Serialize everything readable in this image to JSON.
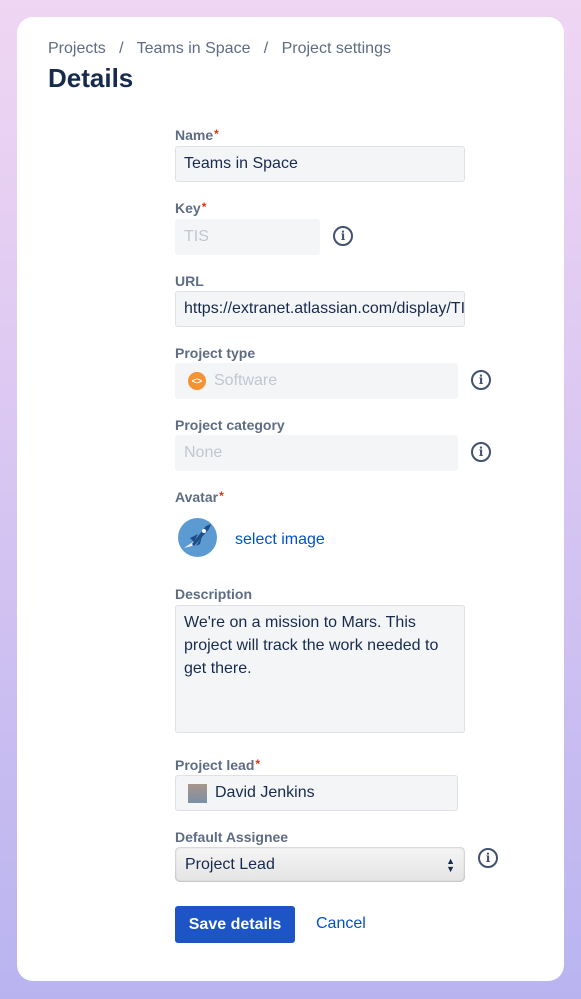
{
  "breadcrumbs": [
    "Projects",
    "Teams in Space",
    "Project settings"
  ],
  "page_title": "Details",
  "fields": {
    "name": {
      "label": "Name",
      "value": "Teams in Space",
      "required": true
    },
    "key": {
      "label": "Key",
      "value": "TIS",
      "required": true
    },
    "url": {
      "label": "URL",
      "value": "https://extranet.atlassian.com/display/TIS"
    },
    "project_type": {
      "label": "Project type",
      "value": "Software",
      "icon": "code-icon",
      "icon_color": "#f79232"
    },
    "project_category": {
      "label": "Project category",
      "placeholder": "None"
    },
    "avatar": {
      "label": "Avatar",
      "link": "select image",
      "required": true
    },
    "description": {
      "label": "Description",
      "value": "We're on a mission to Mars. This project will track the work needed to get there."
    },
    "project_lead": {
      "label": "Project lead",
      "value": "David Jenkins",
      "required": true
    },
    "default_assignee": {
      "label": "Default Assignee",
      "value": "Project Lead"
    }
  },
  "actions": {
    "save": "Save details",
    "cancel": "Cancel"
  },
  "colors": {
    "primary": "#1d55c7",
    "link": "#0052cc",
    "required": "#de350b"
  }
}
